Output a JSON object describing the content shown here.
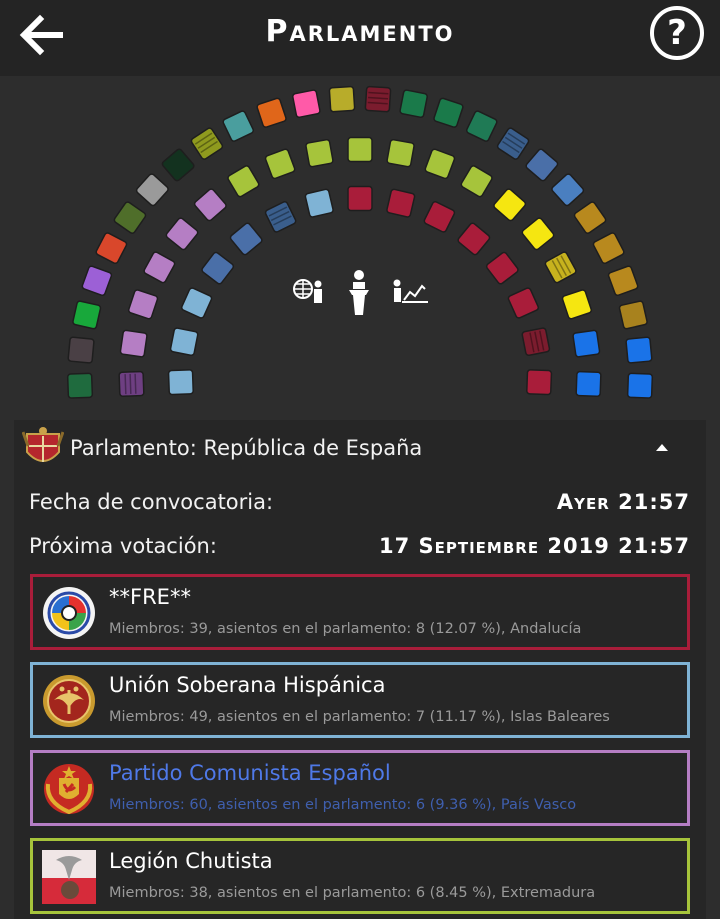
{
  "header": {
    "title": "Parlamento",
    "back_icon": "arrow-left-icon",
    "help_icon": "question-circle-icon",
    "help_glyph": "?"
  },
  "hemicycle": {
    "center_icons": [
      "globe-presenter-icon",
      "podium-speaker-icon",
      "chart-presenter-icon"
    ]
  },
  "panel": {
    "title": "Parlamento: República de España",
    "crest_icon": "coat-of-arms-icon",
    "collapse_icon": "caret-up-icon",
    "rows": [
      {
        "label": "Fecha de convocatoria:",
        "value": "Ayer 21:57"
      },
      {
        "label": "Próxima votación:",
        "value": "17 Septiembre 2019 21:57"
      }
    ],
    "parties": [
      {
        "name": "**FRE**",
        "info": "Miembros: 39, asientos en el parlamento: 8 (12.07 %), Andalucía",
        "color": "#a91d3a",
        "logo": "federation-emblem-icon"
      },
      {
        "name": "Unión Soberana Hispánica",
        "info": "Miembros: 49, asientos en el parlamento: 7 (11.17 %), Islas Baleares",
        "color": "#7fb3d5",
        "logo": "eagle-crest-icon"
      },
      {
        "name": "Partido Comunista Español",
        "info": "Miembros: 60, asientos en el parlamento: 6 (9.36 %), País Vasco",
        "color": "#b57ec4",
        "logo": "communist-crest-icon"
      },
      {
        "name": "Legión Chutista",
        "info": "Miembros: 38, asientos en el parlamento: 6 (8.45 %), Extremadura",
        "color": "#a6c43b",
        "logo": "eagle-flag-icon"
      }
    ]
  }
}
